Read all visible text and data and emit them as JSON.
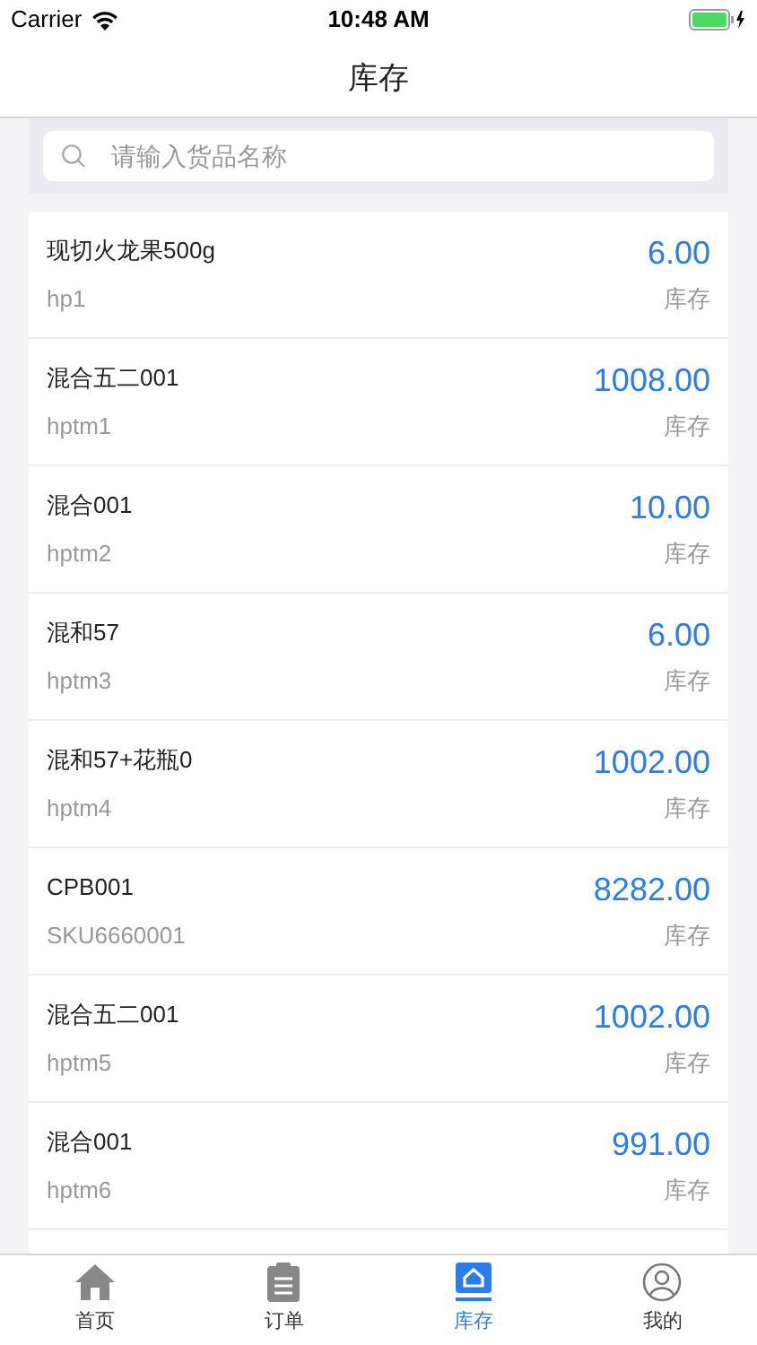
{
  "status_bar": {
    "carrier": "Carrier",
    "time": "10:48 AM"
  },
  "nav": {
    "title": "库存"
  },
  "search": {
    "placeholder": "请输入货品名称"
  },
  "items": [
    {
      "name": "现切火龙果500g",
      "code": "hp1",
      "quantity": "6.00",
      "label": "库存"
    },
    {
      "name": "混合五二001",
      "code": "hptm1",
      "quantity": "1008.00",
      "label": "库存"
    },
    {
      "name": "混合001",
      "code": "hptm2",
      "quantity": "10.00",
      "label": "库存"
    },
    {
      "name": "混和57",
      "code": "hptm3",
      "quantity": "6.00",
      "label": "库存"
    },
    {
      "name": "混和57+花瓶0",
      "code": "hptm4",
      "quantity": "1002.00",
      "label": "库存"
    },
    {
      "name": "CPB001",
      "code": "SKU6660001",
      "quantity": "8282.00",
      "label": "库存"
    },
    {
      "name": "混合五二001",
      "code": "hptm5",
      "quantity": "1002.00",
      "label": "库存"
    },
    {
      "name": "混合001",
      "code": "hptm6",
      "quantity": "991.00",
      "label": "库存"
    }
  ],
  "tabs": [
    {
      "label": "首页",
      "kind": "home",
      "selected": false
    },
    {
      "label": "订单",
      "kind": "clipboard",
      "selected": false
    },
    {
      "label": "库存",
      "kind": "box",
      "selected": true
    },
    {
      "label": "我的",
      "kind": "person",
      "selected": false
    }
  ]
}
